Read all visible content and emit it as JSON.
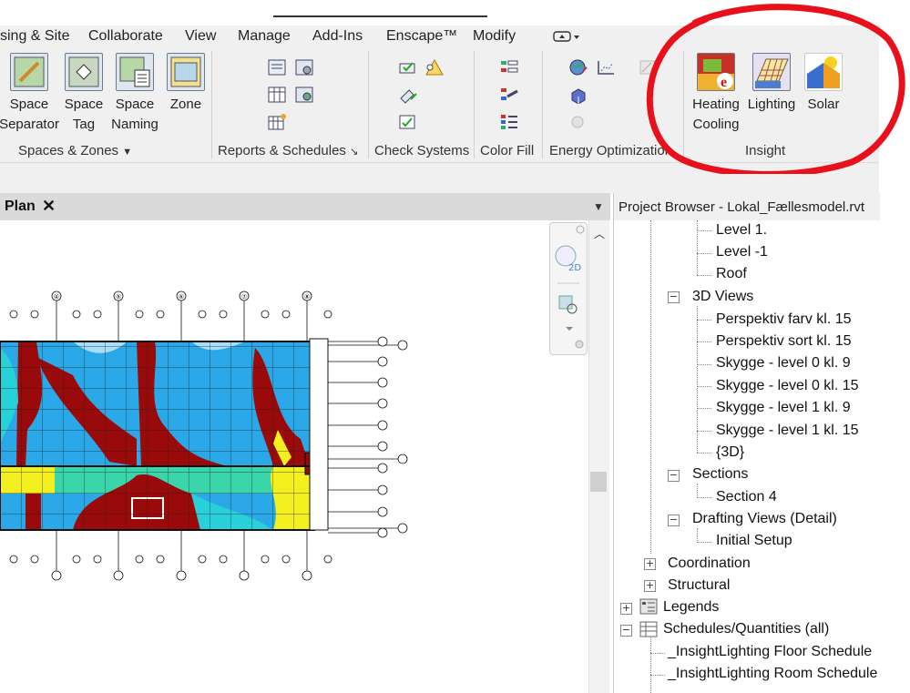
{
  "ribbon_tabs": [
    "sing & Site",
    "Collaborate",
    "View",
    "Manage",
    "Add-Ins",
    "Enscape™",
    "Modify"
  ],
  "panels": {
    "spaces": {
      "buttons": [
        {
          "line1": "Space",
          "line2": "Separator"
        },
        {
          "line1": "Space",
          "line2": "Tag"
        },
        {
          "line1": "Space",
          "line2": "Naming"
        },
        {
          "line1": "Zone",
          "line2": ""
        }
      ],
      "label": "Spaces & Zones"
    },
    "reports": {
      "label": "Reports & Schedules"
    },
    "check": {
      "label": "Check Systems"
    },
    "colorfill": {
      "label": "Color Fill"
    },
    "energy": {
      "label": "Energy Optimization"
    },
    "insight": {
      "label": "Insight",
      "buttons": [
        {
          "line1": "Heating",
          "line2": "Cooling"
        },
        {
          "line1": "Lighting",
          "line2": ""
        },
        {
          "line1": "Solar",
          "line2": ""
        }
      ]
    }
  },
  "view": {
    "tab_label": "Plan",
    "close": "✕"
  },
  "grid_labels_top": [
    "④",
    "⑤",
    "⑥",
    "⑦",
    "⑧"
  ],
  "project_browser": {
    "title": "Project Browser - Lokal_Fællesmodel.rvt",
    "items": [
      {
        "text": "Level 1.",
        "level": 3
      },
      {
        "text": "Level -1",
        "level": 3
      },
      {
        "text": "Roof",
        "level": 3
      },
      {
        "text": "3D Views",
        "level": 2,
        "toggle": "−"
      },
      {
        "text": "Perspektiv farv kl. 15",
        "level": 3
      },
      {
        "text": "Perspektiv sort kl. 15",
        "level": 3
      },
      {
        "text": "Skygge - level 0 kl. 9",
        "level": 3
      },
      {
        "text": "Skygge - level 0 kl. 15",
        "level": 3
      },
      {
        "text": "Skygge - level 1 kl. 9",
        "level": 3
      },
      {
        "text": "Skygge - level 1 kl. 15",
        "level": 3
      },
      {
        "text": "{3D}",
        "level": 3
      },
      {
        "text": "Sections",
        "level": 2,
        "toggle": "−"
      },
      {
        "text": "Section 4",
        "level": 3
      },
      {
        "text": "Drafting Views (Detail)",
        "level": 2,
        "toggle": "−"
      },
      {
        "text": "Initial Setup",
        "level": 3
      },
      {
        "text": "Coordination",
        "level": 1,
        "toggle": "+"
      },
      {
        "text": "Structural",
        "level": 1,
        "toggle": "+"
      },
      {
        "text": "Legends",
        "level": 0,
        "toggle": "+",
        "icon": true
      },
      {
        "text": "Schedules/Quantities (all)",
        "level": 0,
        "toggle": "−",
        "icon": true
      },
      {
        "text": "_InsightLighting Floor Schedule",
        "level": 1
      },
      {
        "text": "_InsightLighting Room Schedule",
        "level": 1
      }
    ]
  },
  "colors": {
    "annotation": "#e8101a",
    "heat_dark": "#9b0a0a",
    "heat_blue": "#2aa8e8"
  }
}
